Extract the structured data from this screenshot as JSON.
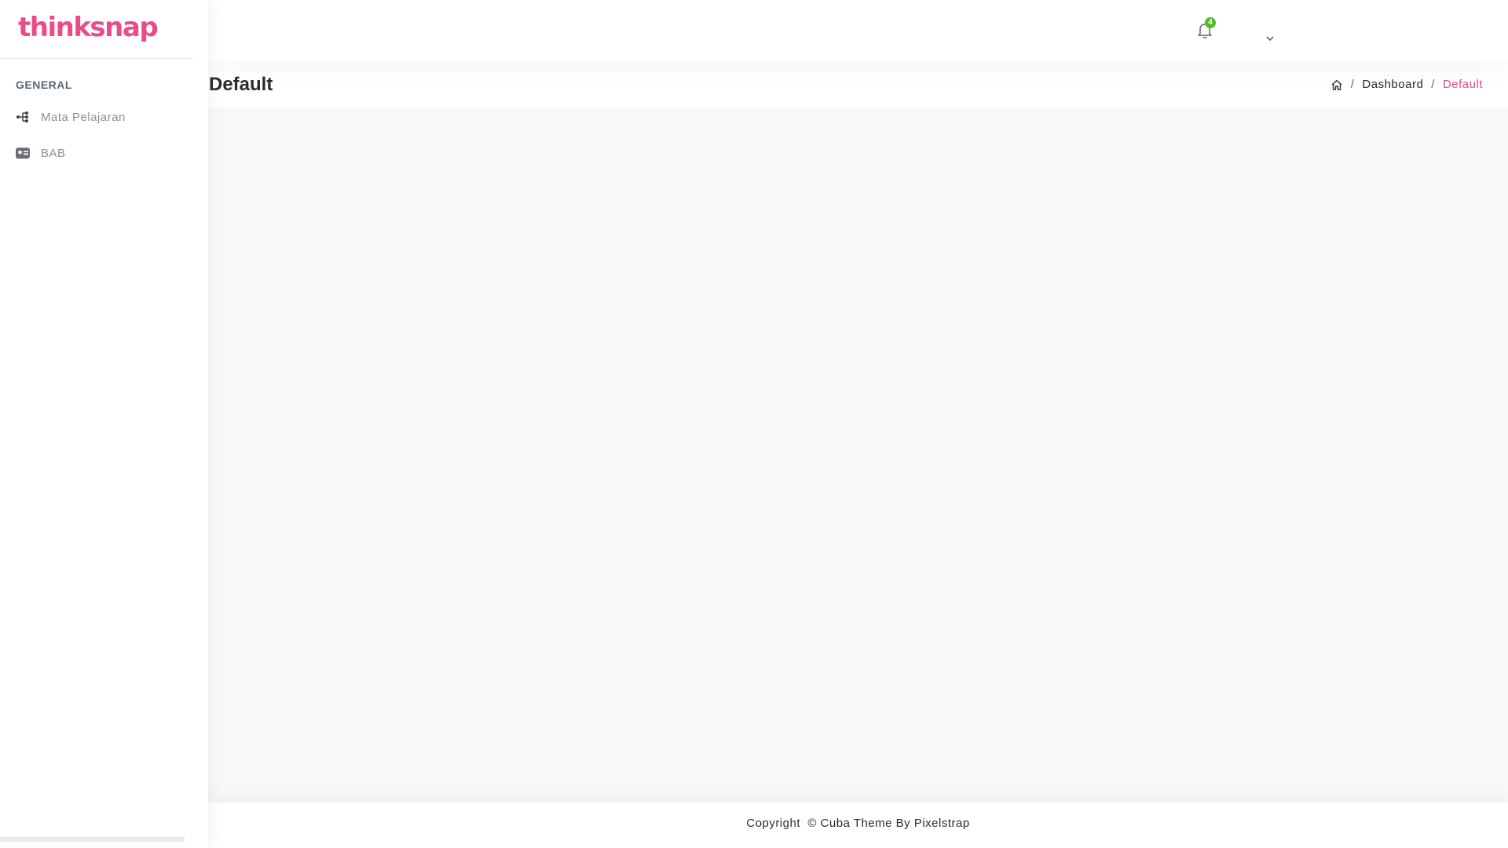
{
  "brand": {
    "logo_text": "thinksnap",
    "accent_color": "#ea4c89"
  },
  "sidebar": {
    "section_heading": "GENERAL",
    "items": [
      {
        "label": "Mata Pelajaran",
        "icon": "tree-icon"
      },
      {
        "label": "BAB",
        "icon": "id-card-icon"
      }
    ]
  },
  "header": {
    "notification_count": "4",
    "notification_badge_color": "#51bb25"
  },
  "page": {
    "title": "Default",
    "breadcrumb": {
      "separator": "/",
      "items": [
        "Dashboard",
        "Default"
      ]
    }
  },
  "footer": {
    "text": "Copyright  © Cuba Theme By Pixelstrap"
  }
}
